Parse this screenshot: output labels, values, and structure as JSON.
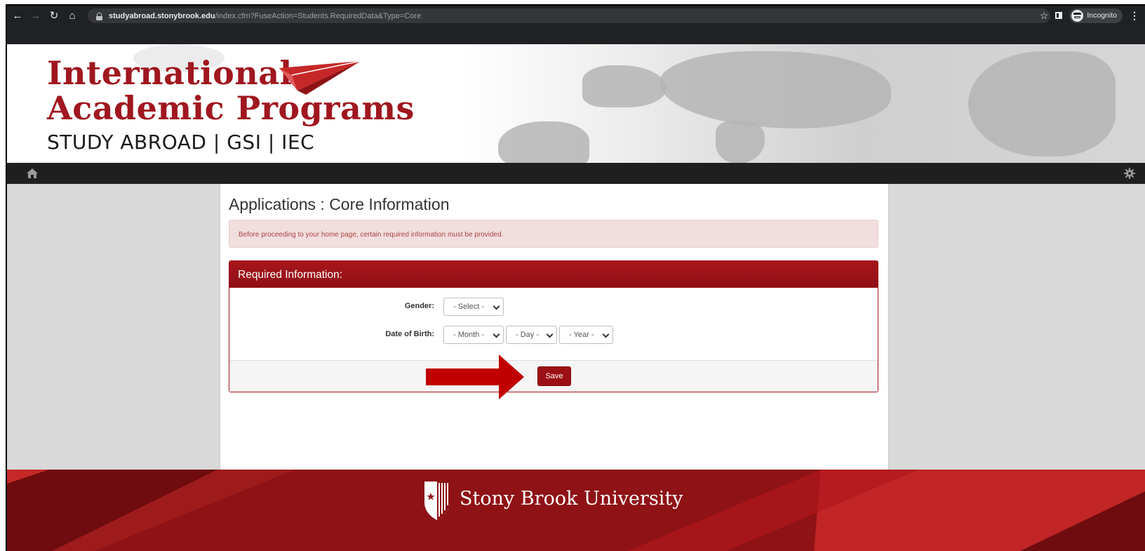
{
  "browser": {
    "url_host": "studyabroad.stonybrook.edu",
    "url_path": "/index.cfm?FuseAction=Students.RequiredData&Type=Core",
    "incognito_label": "Incognito"
  },
  "header": {
    "title_line1": "International",
    "title_line2": "Academic Programs",
    "subtitle": "STUDY ABROAD | GSI | IEC"
  },
  "main": {
    "page_title": "Applications : Core Information",
    "alert_text": "Before proceeding to your home page, certain required information must be provided.",
    "panel_heading": "Required Information:",
    "gender_label": "Gender:",
    "gender_value": "- Select -",
    "dob_label": "Date of Birth:",
    "month_value": "- Month -",
    "day_value": "- Day -",
    "year_value": "- Year -",
    "save_label": "Save"
  },
  "footer": {
    "university_name": "Stony Brook University"
  },
  "colors": {
    "brand_red": "#a0171f",
    "footer_red": "#8e1216",
    "arrow_red": "#c00000"
  },
  "icons": [
    "back-arrow-icon",
    "forward-arrow-icon",
    "reload-icon",
    "home-icon",
    "lock-icon",
    "star-icon",
    "side-panel-icon",
    "incognito-icon",
    "menu-dots-icon",
    "gear-icon",
    "paper-plane-icon",
    "sbu-shield-icon"
  ]
}
